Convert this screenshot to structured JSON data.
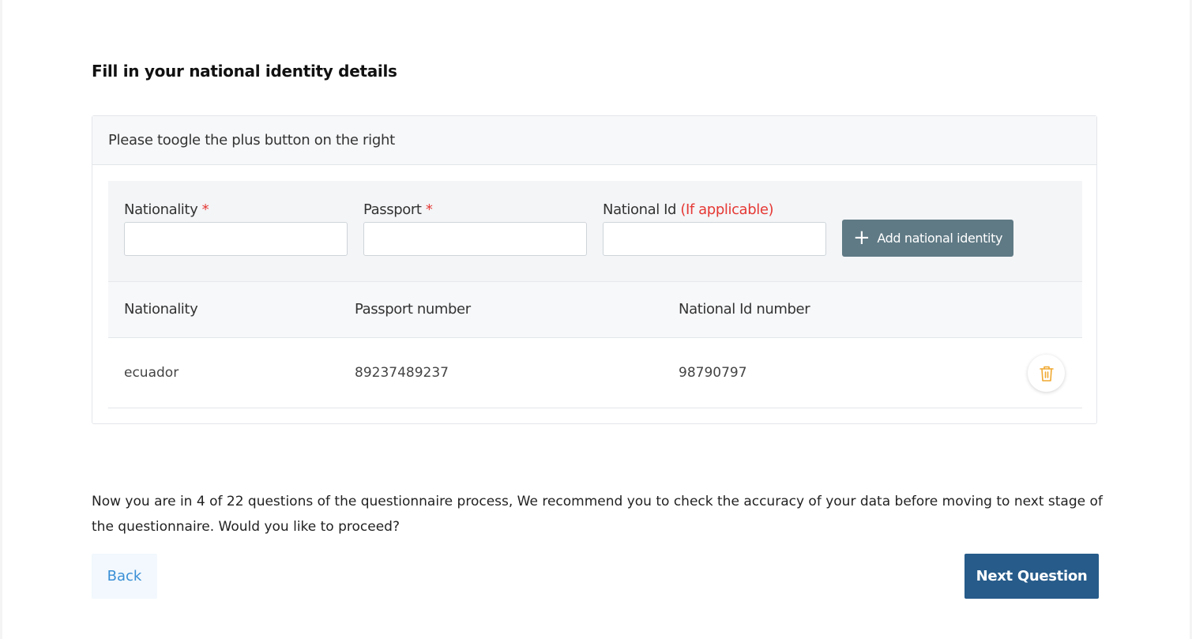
{
  "form": {
    "title": "Fill in your national identity details",
    "card_header": "Please toogle the plus button on the right",
    "fields": {
      "nationality": {
        "label": "Nationality",
        "required_mark": "*",
        "value": ""
      },
      "passport": {
        "label": "Passport",
        "required_mark": "*",
        "value": ""
      },
      "national_id": {
        "label": "National Id",
        "note": "(If applicable)",
        "value": ""
      }
    },
    "add_button_label": "Add national identity",
    "add_button_icon": "plus-icon"
  },
  "table": {
    "headers": [
      "Nationality",
      "Passport number",
      "National Id number"
    ],
    "rows": [
      {
        "nationality": "ecuador",
        "passport": "89237489237",
        "national_id": "98790797",
        "action_icon": "trash-icon"
      }
    ]
  },
  "progress": {
    "message": "Now you are in 4 of 22 questions of the questionnaire process, We recommend you to check the accuracy of your data before moving to next stage of the questionnaire. Would you like to proceed?",
    "current": 4,
    "total": 22
  },
  "nav": {
    "back_label": "Back",
    "next_label": "Next Question"
  },
  "colors": {
    "primary": "#265b8a",
    "add_button": "#5f7a85",
    "required": "#e53935",
    "link": "#3a8fd6",
    "delete_icon": "#f0a830"
  }
}
